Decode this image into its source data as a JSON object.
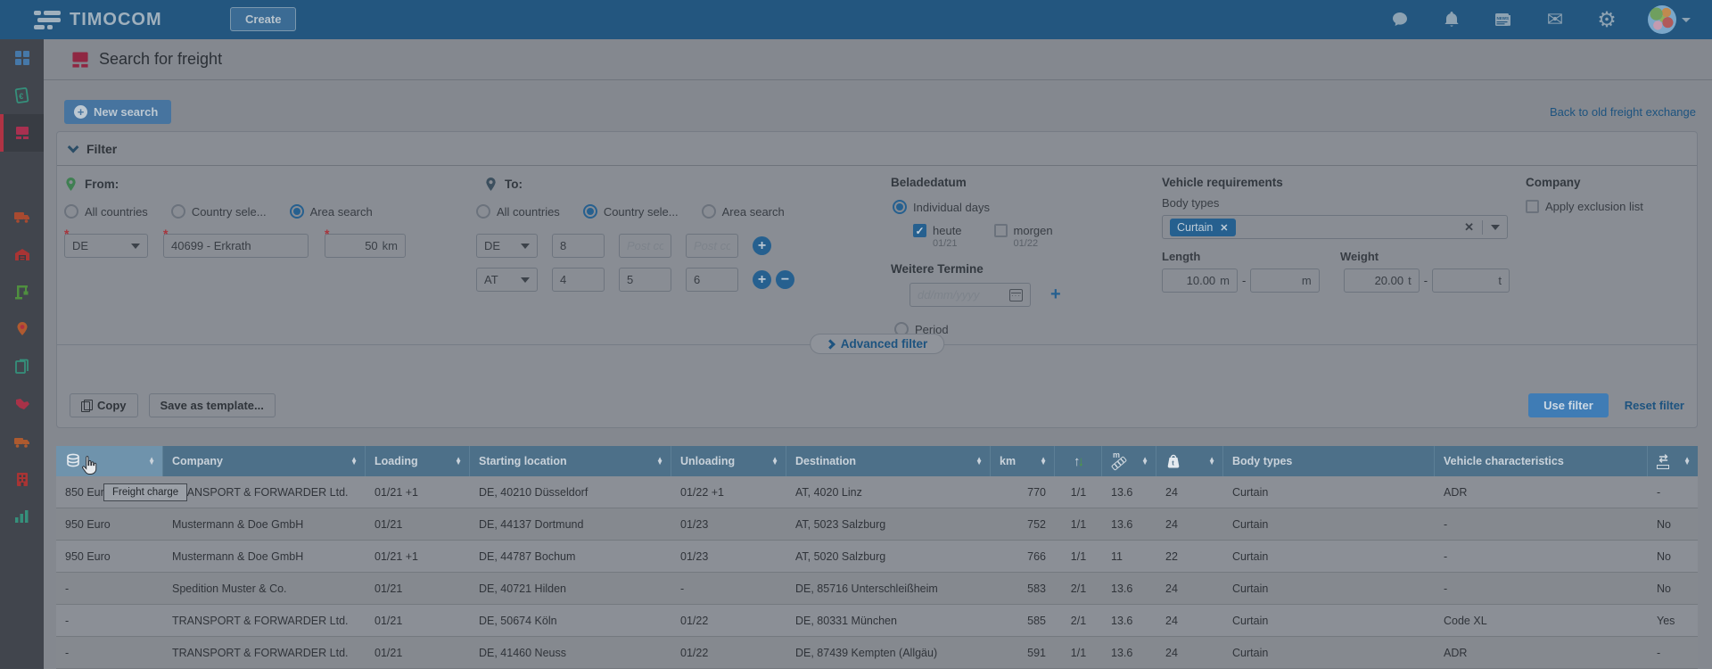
{
  "topbar": {
    "brand": "TIMOCOM",
    "create_label": "Create"
  },
  "icons": {
    "chat": "chat-bubble",
    "notifications": "bell",
    "news": "newspaper",
    "mail": "envelope",
    "settings": "gear",
    "account": "avatar-europe-map",
    "freight": "pallet",
    "sort": "up-down-triangles",
    "freight_charge": "coins",
    "stops": "up-down-arrows",
    "length": "ruler-m",
    "weight": "weight-t",
    "pallet_exchange": "swap-arrows-pallet"
  },
  "page": {
    "title": "Search for freight",
    "new_search_label": "New search",
    "back_link": "Back to old freight exchange"
  },
  "filter": {
    "title": "Filter",
    "from": {
      "label": "From:",
      "opt_all": "All countries",
      "opt_country": "Country sele...",
      "opt_area": "Area search",
      "country": "DE",
      "city": "40699 - Erkrath",
      "radius": "50",
      "radius_unit": "km"
    },
    "to": {
      "label": "To:",
      "opt_all": "All countries",
      "opt_country": "Country sele...",
      "opt_area": "Area search",
      "row1_country": "DE",
      "row1_code1": "8",
      "row1_ph2": "Post cod",
      "row1_ph3": "Post cod",
      "row2_country": "AT",
      "row2_code1": "4",
      "row2_code2": "5",
      "row2_code3": "6"
    },
    "date": {
      "title": "Beladedatum",
      "individual_label": "Individual days",
      "today_label": "heute",
      "today_date": "01/21",
      "tomorrow_label": "morgen",
      "tomorrow_date": "01/22",
      "more_dates_label": "Weitere Termine",
      "date_placeholder": "dd/mm/yyyy",
      "period_label": "Period"
    },
    "vehicle": {
      "title": "Vehicle requirements",
      "body_types_label": "Body types",
      "body_type_tag": "Curtain",
      "length_label": "Length",
      "length_from": "10.00",
      "length_unit": "m",
      "weight_label": "Weight",
      "weight_from": "20.00",
      "weight_unit": "t"
    },
    "company": {
      "title": "Company",
      "exclusion_label": "Apply exclusion list"
    },
    "advanced_label": "Advanced filter",
    "actions": {
      "copy": "Copy",
      "save_template": "Save as template...",
      "use": "Use filter",
      "reset": "Reset filter"
    }
  },
  "table": {
    "tooltip": "Freight charge",
    "headers": {
      "company": "Company",
      "loading": "Loading",
      "start": "Starting location",
      "unloading": "Unloading",
      "destination": "Destination",
      "km": "km",
      "body_types": "Body types",
      "vehicle_chars": "Vehicle characteristics"
    },
    "rows": [
      {
        "charge": "850 Euro",
        "company": "TRANSPORT & FORWARDER Ltd.",
        "loading": "01/21 +1",
        "start": "DE, 40210 Düsseldorf",
        "unloading": "01/22 +1",
        "dest": "AT, 4020 Linz",
        "km": "770",
        "stops": "1/1",
        "len": "13.6",
        "wt": "24",
        "body": "Curtain",
        "chars": "ADR",
        "pallet": "-"
      },
      {
        "charge": "950 Euro",
        "company": "Mustermann & Doe GmbH",
        "loading": "01/21",
        "start": "DE, 44137 Dortmund",
        "unloading": "01/23",
        "dest": "AT, 5023 Salzburg",
        "km": "752",
        "stops": "1/1",
        "len": "13.6",
        "wt": "24",
        "body": "Curtain",
        "chars": "-",
        "pallet": "No"
      },
      {
        "charge": "950 Euro",
        "company": "Mustermann & Doe GmbH",
        "loading": "01/21 +1",
        "start": "DE, 44787 Bochum",
        "unloading": "01/23",
        "dest": "AT, 5020 Salzburg",
        "km": "766",
        "stops": "1/1",
        "len": "11",
        "wt": "22",
        "body": "Curtain",
        "chars": "-",
        "pallet": "No"
      },
      {
        "charge": "-",
        "company": "Spedition Muster & Co.",
        "loading": "01/21",
        "start": "DE, 40721 Hilden",
        "unloading": "-",
        "dest": "DE, 85716 Unterschleißheim",
        "km": "583",
        "stops": "2/1",
        "len": "13.6",
        "wt": "24",
        "body": "Curtain",
        "chars": "-",
        "pallet": "No"
      },
      {
        "charge": "-",
        "company": "TRANSPORT & FORWARDER Ltd.",
        "loading": "01/21",
        "start": "DE, 50674 Köln",
        "unloading": "01/22",
        "dest": "DE, 80331 München",
        "km": "585",
        "stops": "2/1",
        "len": "13.6",
        "wt": "24",
        "body": "Curtain",
        "chars": "Code XL",
        "pallet": "Yes"
      },
      {
        "charge": "-",
        "company": "TRANSPORT & FORWARDER Ltd.",
        "loading": "01/21",
        "start": "DE, 41460 Neuss",
        "unloading": "01/22",
        "dest": "DE, 87439 Kempten (Allgäu)",
        "km": "591",
        "stops": "1/1",
        "len": "13.6",
        "wt": "24",
        "body": "Curtain",
        "chars": "ADR",
        "pallet": "-"
      }
    ]
  },
  "colors": {
    "topbar": "#23567f",
    "accent_blue": "#26608f",
    "header_blue": "#4d7089",
    "active_red": "#b03344",
    "primary_button": "#3f7cb5"
  }
}
